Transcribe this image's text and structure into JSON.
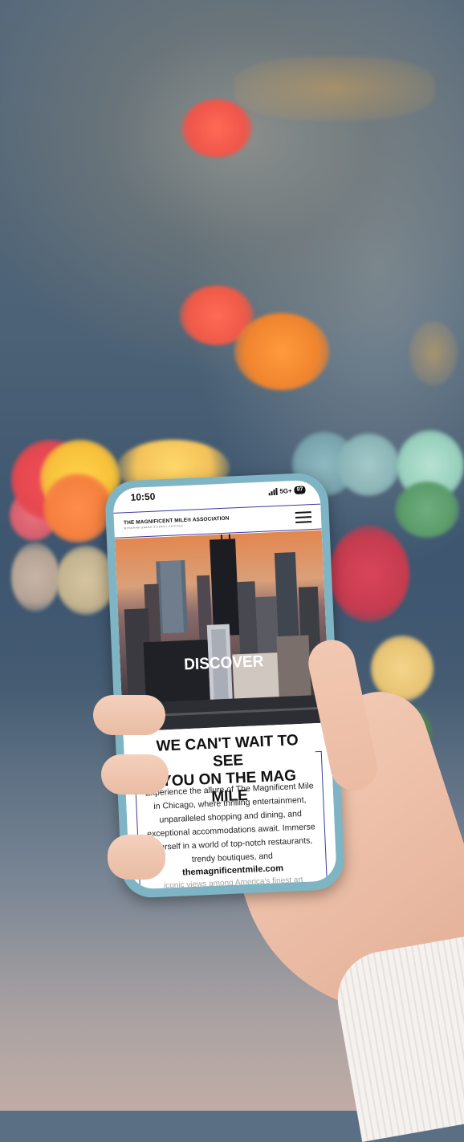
{
  "phone": {
    "status_time": "10:50",
    "network": "5G+",
    "battery": "97"
  },
  "site": {
    "logo_title": "THE MAGNIFICENT MILE® ASSOCIATION",
    "logo_subtitle": "WYNDHAM GRAND RIVERS | CHICAGO",
    "hero_title": "DISCOVER",
    "heading_line1": "WE CAN'T WAIT TO SEE",
    "heading_line2": "YOU ON THE MAG MILE",
    "body": "Experience the allure of The Magnificent Mile in Chicago, where thrilling entertainment, unparalleled shopping and dining, and exceptional accommodations await. Immerse yourself in a world of top-notch restaurants, trendy boutiques, and",
    "cutoff_line": "iconic views among America's finest art",
    "url": "themagnificentmile.com"
  },
  "colors": {
    "phone_case": "#7fb4c4",
    "accent_border": "#3a3aa0"
  }
}
